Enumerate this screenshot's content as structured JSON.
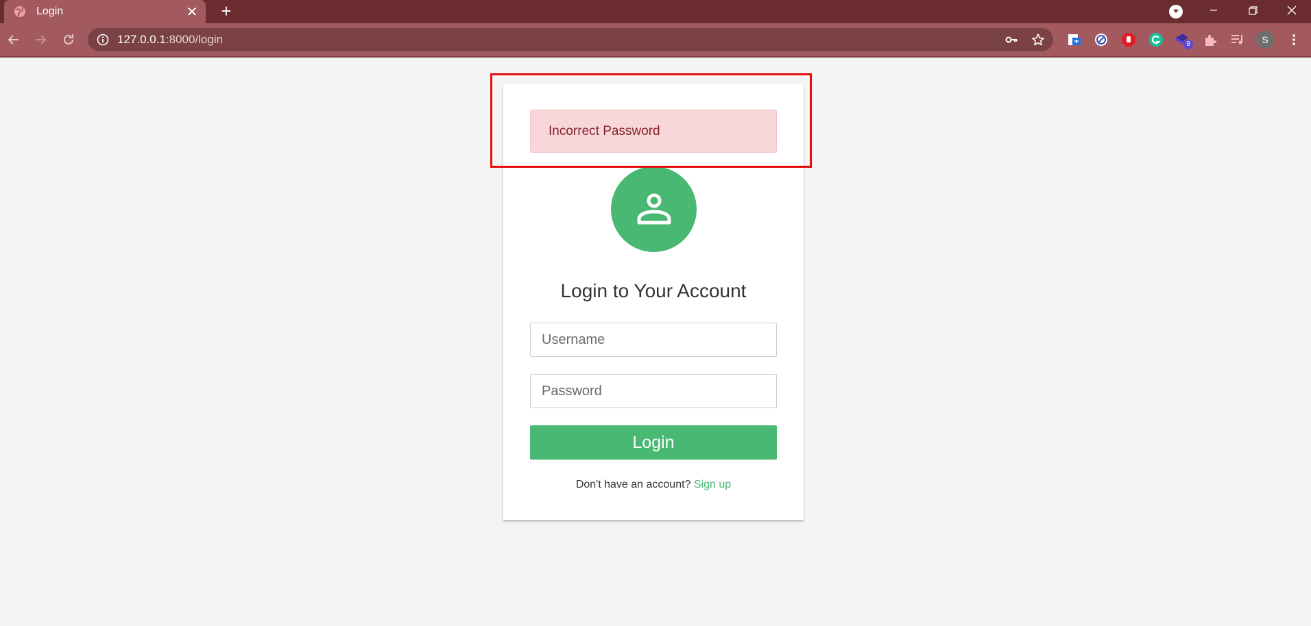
{
  "browser": {
    "tab_title": "Login",
    "tab_close": "✕",
    "new_tab": "+",
    "url_host": "127.0.0.1",
    "url_path": ":8000/login",
    "profile_initial": "S",
    "extension_badge": "9"
  },
  "alert": {
    "message": "Incorrect Password"
  },
  "login": {
    "heading": "Login to Your Account",
    "username_placeholder": "Username",
    "password_placeholder": "Password",
    "button_label": "Login",
    "signup_prompt": "Don't have an account? ",
    "signup_link": "Sign up"
  },
  "colors": {
    "chrome_dark": "#6b2c2f",
    "chrome_toolbar": "#a25a5e",
    "accent_green": "#48b872",
    "alert_bg": "#f8d7da",
    "alert_text": "#842029",
    "highlight_red": "#e30d0d"
  }
}
